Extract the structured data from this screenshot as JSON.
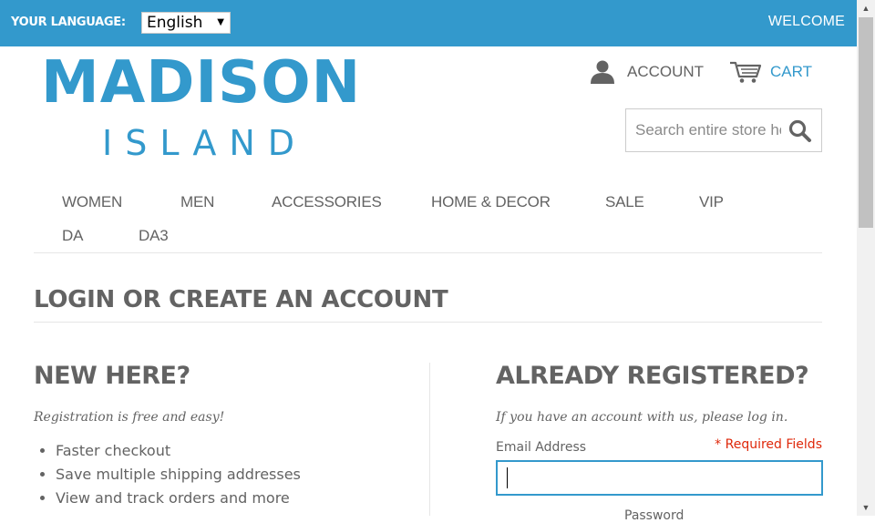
{
  "header": {
    "language_label": "YOUR LANGUAGE:",
    "language_selected": "English",
    "welcome": "WELCOME"
  },
  "logo": {
    "line1": "MADISON",
    "line2": "ISLAND"
  },
  "account": {
    "label": "ACCOUNT"
  },
  "cart": {
    "label": "CART"
  },
  "search": {
    "placeholder": "Search entire store here..."
  },
  "nav": {
    "items": [
      "WOMEN",
      "MEN",
      "ACCESSORIES",
      "HOME & DECOR",
      "SALE",
      "VIP",
      "DA",
      "DA3"
    ]
  },
  "page": {
    "title": "LOGIN OR CREATE AN ACCOUNT"
  },
  "new_customer": {
    "title": "NEW HERE?",
    "subtitle": "Registration is free and easy!",
    "benefits": [
      "Faster checkout",
      "Save multiple shipping addresses",
      "View and track orders and more"
    ]
  },
  "registered": {
    "title": "ALREADY REGISTERED?",
    "subtitle": "If you have an account with us, please log in.",
    "email_label": "Email Address",
    "required_note": "* Required Fields",
    "email_value": "",
    "password_label": "Password"
  },
  "colors": {
    "brand": "#3399cc",
    "text": "#636363",
    "required": "#df280a"
  }
}
